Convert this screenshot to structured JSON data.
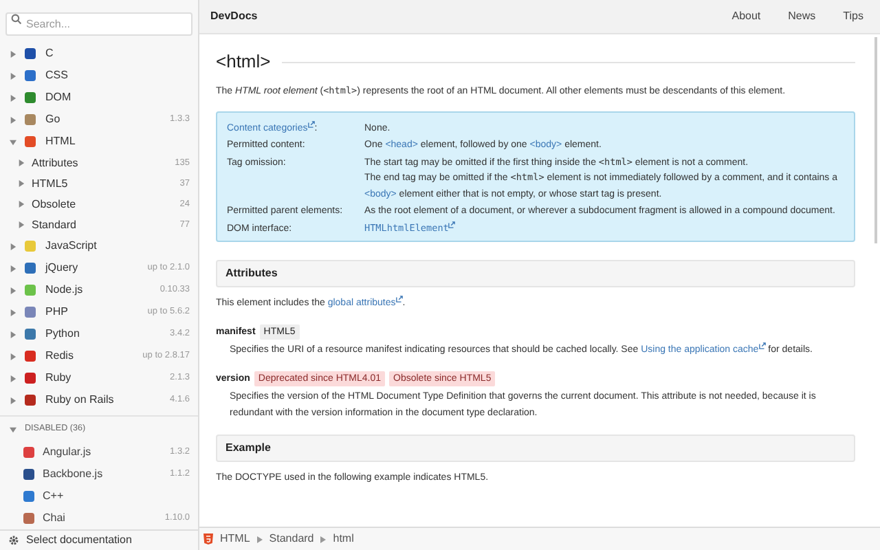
{
  "sidebar": {
    "search": {
      "placeholder": "Search..."
    },
    "docs": [
      {
        "name": "C",
        "color": "#1e4fa8",
        "expanded": false
      },
      {
        "name": "CSS",
        "color": "#2c6fc9",
        "expanded": false
      },
      {
        "name": "DOM",
        "color": "#2e8b2e",
        "expanded": false
      },
      {
        "name": "Go",
        "version": "1.3.3",
        "color": "#a88860",
        "expanded": false
      },
      {
        "name": "HTML",
        "color": "#e34c26",
        "expanded": true,
        "children": [
          {
            "name": "Attributes",
            "count": "135"
          },
          {
            "name": "HTML5",
            "count": "37"
          },
          {
            "name": "Obsolete",
            "count": "24"
          },
          {
            "name": "Standard",
            "count": "77"
          }
        ]
      },
      {
        "name": "JavaScript",
        "color": "#e8c93a",
        "expanded": false
      },
      {
        "name": "jQuery",
        "version": "up to 2.1.0",
        "color": "#2e6fb8",
        "expanded": false
      },
      {
        "name": "Node.js",
        "version": "0.10.33",
        "color": "#6cc24a",
        "expanded": false
      },
      {
        "name": "PHP",
        "version": "up to 5.6.2",
        "color": "#7a86b8",
        "expanded": false
      },
      {
        "name": "Python",
        "version": "3.4.2",
        "color": "#3c78aa",
        "expanded": false
      },
      {
        "name": "Redis",
        "version": "up to 2.8.17",
        "color": "#d82c20",
        "expanded": false
      },
      {
        "name": "Ruby",
        "version": "2.1.3",
        "color": "#cc2020",
        "expanded": false
      },
      {
        "name": "Ruby on Rails",
        "version": "4.1.6",
        "color": "#b52a1d",
        "expanded": false
      }
    ],
    "disabled": {
      "label": "DISABLED (36)",
      "expanded": true,
      "items": [
        {
          "name": "Angular.js",
          "version": "1.3.2",
          "color": "#dd4040"
        },
        {
          "name": "Backbone.js",
          "version": "1.1.2",
          "color": "#2a4f8c"
        },
        {
          "name": "C++",
          "color": "#2f7ad0"
        },
        {
          "name": "Chai",
          "version": "1.10.0",
          "color": "#b86a50"
        }
      ]
    },
    "footer": "Select documentation"
  },
  "header": {
    "title": "DevDocs",
    "links": [
      "About",
      "News",
      "Tips"
    ]
  },
  "content": {
    "title": "<html>",
    "intro": [
      {
        "kind": "text",
        "text": "The "
      },
      {
        "kind": "em",
        "text": "HTML root element"
      },
      {
        "kind": "text",
        "text": " ("
      },
      {
        "kind": "code",
        "text": "<html>"
      },
      {
        "kind": "text",
        "text": ") represents the root of an HTML document. All other elements must be descendants of this element."
      }
    ],
    "info": [
      {
        "label": [
          {
            "kind": "link",
            "text": "Content categories"
          },
          {
            "kind": "text",
            "text": ":"
          }
        ],
        "value": [
          [
            {
              "kind": "text",
              "text": "None."
            }
          ]
        ]
      },
      {
        "label": [
          {
            "kind": "text",
            "text": "Permitted content:"
          }
        ],
        "value": [
          [
            {
              "kind": "text",
              "text": "One "
            },
            {
              "kind": "tag",
              "text": "<head>"
            },
            {
              "kind": "text",
              "text": " element, followed by one "
            },
            {
              "kind": "tag",
              "text": "<body>"
            },
            {
              "kind": "text",
              "text": " element."
            }
          ]
        ]
      },
      {
        "label": [
          {
            "kind": "text",
            "text": "Tag omission:"
          }
        ],
        "value": [
          [
            {
              "kind": "text",
              "text": "The start tag may be omitted if the first thing inside the "
            },
            {
              "kind": "code",
              "text": "<html>"
            },
            {
              "kind": "text",
              "text": " element is not a comment."
            }
          ],
          [
            {
              "kind": "text",
              "text": "The end tag may be omitted if the "
            },
            {
              "kind": "code",
              "text": "<html>"
            },
            {
              "kind": "text",
              "text": " element is not immediately followed by a comment, and it contains a "
            },
            {
              "kind": "tag",
              "text": "<body>"
            },
            {
              "kind": "text",
              "text": " element either that is not empty, or whose start tag is present."
            }
          ]
        ]
      },
      {
        "label": [
          {
            "kind": "text",
            "text": "Permitted parent elements:"
          }
        ],
        "value": [
          [
            {
              "kind": "text",
              "text": "As the root element of a document, or wherever a subdocument fragment is allowed in a compound document."
            }
          ]
        ]
      },
      {
        "label": [
          {
            "kind": "text",
            "text": "DOM interface:"
          }
        ],
        "value": [
          [
            {
              "kind": "codelink",
              "text": "HTMLhtmlElement"
            }
          ]
        ]
      }
    ],
    "sections": [
      {
        "heading": "Attributes",
        "body": [
          {
            "kind": "text",
            "text": "This element includes the "
          },
          {
            "kind": "link",
            "text": "global attributes"
          },
          {
            "kind": "text",
            "text": "."
          }
        ],
        "attributes": [
          {
            "name": "manifest",
            "badges": [
              {
                "text": "HTML5",
                "kind": "neutral"
              }
            ],
            "description": [
              {
                "kind": "text",
                "text": "Specifies the URI of a resource manifest indicating resources that should be cached locally. See "
              },
              {
                "kind": "link",
                "text": "Using the application cache"
              },
              {
                "kind": "text",
                "text": " for details."
              }
            ]
          },
          {
            "name": "version",
            "badges": [
              {
                "text": "Deprecated since HTML4.01",
                "kind": "deprecated"
              },
              {
                "text": "Obsolete since HTML5",
                "kind": "deprecated"
              }
            ],
            "description": [
              {
                "kind": "text",
                "text": "Specifies the version of the HTML Document Type Definition that governs the current document. This attribute is not needed, because it is redundant with the version information in the document type declaration."
              }
            ]
          }
        ]
      },
      {
        "heading": "Example",
        "body": [
          {
            "kind": "text",
            "text": "The DOCTYPE used in the following example indicates HTML5."
          }
        ]
      }
    ]
  },
  "breadcrumb": [
    "HTML",
    "Standard",
    "html"
  ]
}
